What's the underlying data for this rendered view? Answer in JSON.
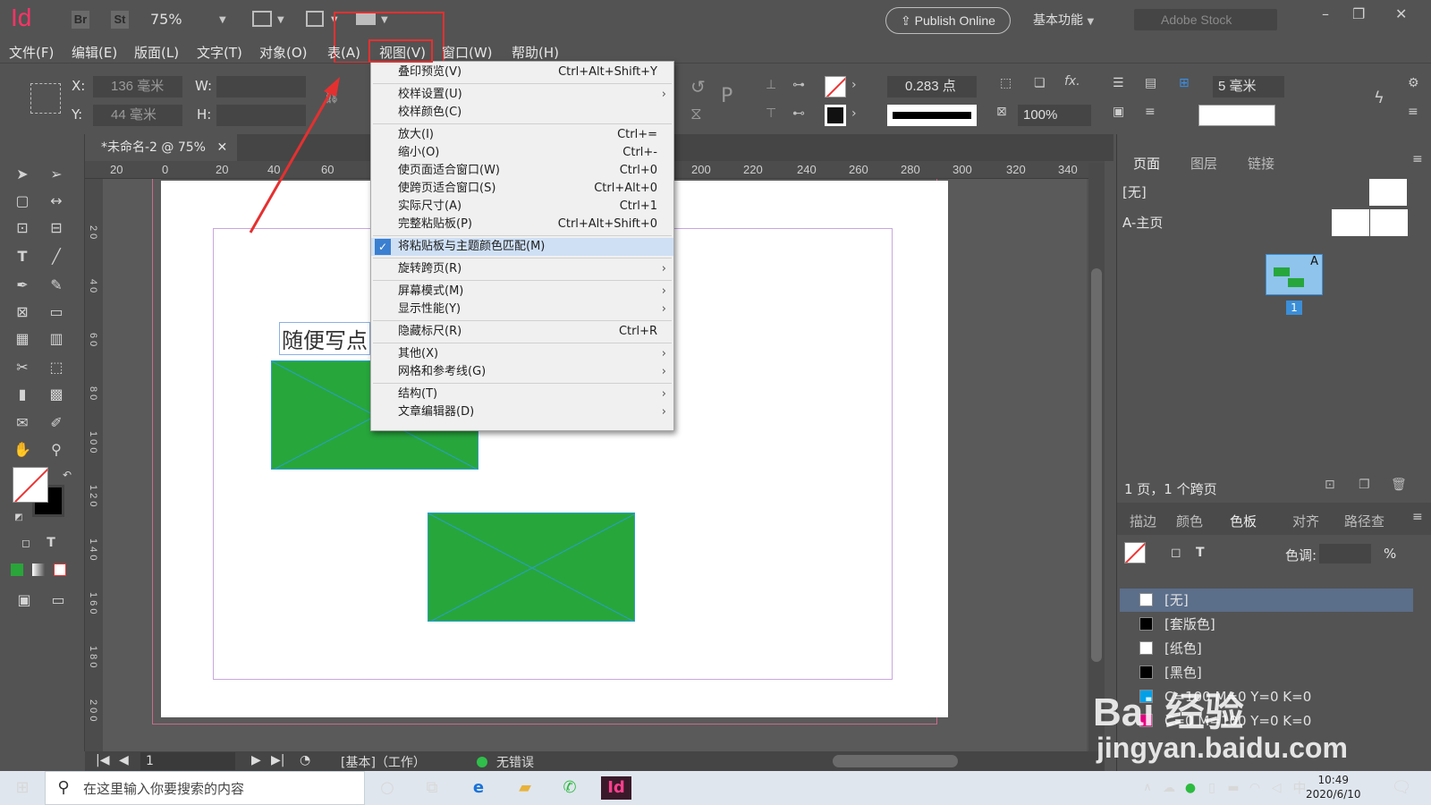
{
  "app": {
    "logo": "Id",
    "bridge": "Br",
    "stock_app": "St",
    "zoom": "75%",
    "publish": "Publish Online",
    "workspace": "基本功能",
    "stock_search_placeholder": "Adobe Stock"
  },
  "menubar": [
    "文件(F)",
    "编辑(E)",
    "版面(L)",
    "文字(T)",
    "对象(O)",
    "表(A)",
    "视图(V)",
    "窗口(W)",
    "帮助(H)"
  ],
  "control": {
    "x_label": "X:",
    "x_value": "136 毫米",
    "y_label": "Y:",
    "y_value": "44 毫米",
    "w_label": "W:",
    "h_label": "H:",
    "stroke_weight": "0.283 点",
    "scale": "100%",
    "spacing": "5 毫米"
  },
  "document_tab": "*未命名-2 @ 75%",
  "ruler_ticks": [
    "20",
    "0",
    "20",
    "40",
    "60",
    "200",
    "220",
    "240",
    "260",
    "280",
    "300",
    "320",
    "340"
  ],
  "vruler_ticks": [
    "2 0",
    "4 0",
    "6 0",
    "8 0",
    "1 0 0",
    "1 2 0",
    "1 4 0",
    "1 6 0",
    "1 8 0",
    "2 0 0"
  ],
  "canvas": {
    "text": "随便写点"
  },
  "view_menu": {
    "items": [
      {
        "label": "叠印预览(V)",
        "shortcut": "Ctrl+Alt+Shift+Y"
      },
      {
        "label": "校样设置(U)",
        "submenu": true
      },
      {
        "label": "校样颜色(C)"
      },
      {
        "label": "放大(I)",
        "shortcut": "Ctrl+="
      },
      {
        "label": "缩小(O)",
        "shortcut": "Ctrl+-"
      },
      {
        "label": "使页面适合窗口(W)",
        "shortcut": "Ctrl+0"
      },
      {
        "label": "使跨页适合窗口(S)",
        "shortcut": "Ctrl+Alt+0"
      },
      {
        "label": "实际尺寸(A)",
        "shortcut": "Ctrl+1"
      },
      {
        "label": "完整粘贴板(P)",
        "shortcut": "Ctrl+Alt+Shift+0"
      },
      {
        "label": "将粘贴板与主题颜色匹配(M)",
        "checked": true
      },
      {
        "label": "旋转跨页(R)",
        "submenu": true
      },
      {
        "label": "屏幕模式(M)",
        "submenu": true
      },
      {
        "label": "显示性能(Y)",
        "submenu": true
      },
      {
        "label": "隐藏标尺(R)",
        "shortcut": "Ctrl+R"
      },
      {
        "label": "其他(X)",
        "submenu": true
      },
      {
        "label": "网格和参考线(G)",
        "submenu": true
      },
      {
        "label": "结构(T)",
        "submenu": true
      },
      {
        "label": "文章编辑器(D)",
        "submenu": true
      }
    ]
  },
  "pages_panel": {
    "tabs": [
      "页面",
      "图层",
      "链接"
    ],
    "none_master": "[无]",
    "a_master": "A-主页",
    "page_badge": "A",
    "page_number": "1",
    "summary": "1 页，1 个跨页"
  },
  "swatches_panel": {
    "tabs": [
      "描边",
      "颜色",
      "色板",
      "对齐",
      "路径查"
    ],
    "tint_label": "色调:",
    "percent": "%",
    "swatches": [
      {
        "name": "[无]",
        "color": "#ffffff"
      },
      {
        "name": "[套版色]",
        "color": "#000000"
      },
      {
        "name": "[纸色]",
        "color": "#ffffff"
      },
      {
        "name": "[黑色]",
        "color": "#000000"
      },
      {
        "name": "C=100 M=0 Y=0 K=0",
        "color": "#00a0e9"
      },
      {
        "name": "C=0 M=100 Y=0 K=0",
        "color": "#e4007f"
      }
    ]
  },
  "status": {
    "page": "1",
    "master": "[基本]（工作）",
    "preflight": "无错误"
  },
  "taskbar": {
    "search_placeholder": "在这里输入你要搜索的内容",
    "ime": "中",
    "time": "10:49",
    "date": "2020/6/10"
  },
  "watermark": {
    "line1": "Bai 经验",
    "line2": "jingyan.baidu.com"
  },
  "colors": {
    "accent_red": "#e53030",
    "rect_green": "#27a63c",
    "logo_pink": "#ff3366"
  }
}
